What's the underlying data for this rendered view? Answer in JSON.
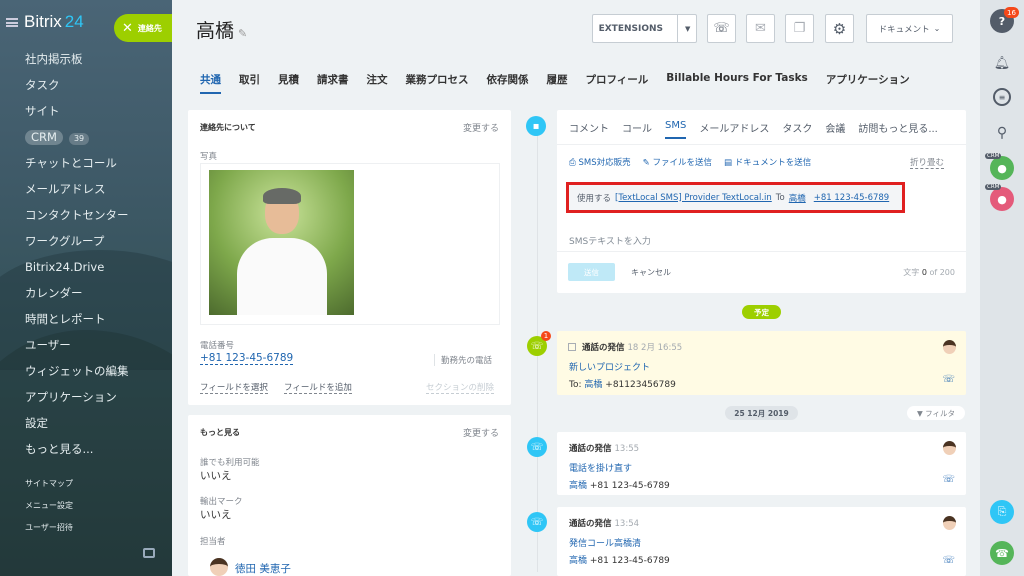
{
  "sidebar": {
    "logo_text": "Bitrix",
    "logo_num": "24",
    "contact_button": "連絡先",
    "menu": [
      "社内掲示板",
      "タスク",
      "サイト",
      "CRM",
      "チャットとコール",
      "メールアドレス",
      "コンタクトセンター",
      "ワークグループ",
      "Bitrix24.Drive",
      "カレンダー",
      "時間とレポート",
      "ユーザー",
      "ウィジェットの編集",
      "アプリケーション",
      "設定",
      "もっと見る..."
    ],
    "crm_count": "39",
    "submenu": [
      "サイトマップ",
      "メニュー設定",
      "ユーザー招待"
    ]
  },
  "header": {
    "title": "高橋",
    "extensions": "EXTENSIONS",
    "documents": "ドキュメント"
  },
  "tabs": [
    "共通",
    "取引",
    "見積",
    "請求書",
    "注文",
    "業務プロセス",
    "依存関係",
    "履歴",
    "プロフィール",
    "Billable Hours For Tasks",
    "アプリケーション"
  ],
  "about": {
    "title": "連絡先について",
    "edit": "変更する",
    "photo_label": "写真",
    "phone_label": "電話番号",
    "phone": "+81 123-45-6789",
    "phone_type": "勤務先の電話",
    "select_field": "フィールドを選択",
    "add_field": "フィールドを追加",
    "delete_section": "セクションの削除"
  },
  "more": {
    "title": "もっと見る",
    "edit": "変更する",
    "available_label": "誰でも利用可能",
    "available_value": "いいえ",
    "import_label": "輸出マーク",
    "import_value": "いいえ",
    "owner_label": "担当者",
    "owner_name": "徳田 美恵子"
  },
  "activity": {
    "tabs": [
      "コメント",
      "コール",
      "SMS",
      "メールアドレス",
      "タスク",
      "会議",
      "訪問もっと見る..."
    ],
    "tools": [
      "SMS対応販売",
      "ファイルを送信",
      "ドキュメントを送信"
    ],
    "fold": "折り畳む",
    "provider_prefix": "使用する",
    "provider": "[TextLocal SMS] Provider TextLocal.in",
    "to": "To",
    "to_name": "高橋",
    "to_phone": "+81 123-45-6789",
    "placeholder": "SMSテキストを入力",
    "send": "送信",
    "cancel": "キャンセル",
    "counter_label": "文字",
    "counter": "0",
    "counter_of": "of",
    "counter_max": "200"
  },
  "timeline": {
    "planned": "予定",
    "date": "25 12月 2019",
    "filter": "フィルタ",
    "badge": "1",
    "events": [
      {
        "title": "通話の発信",
        "time": "18 2月 16:55",
        "subject": "新しいプロジェクト",
        "line2_prefix": "To:",
        "line2_name": "高橋",
        "line2_phone": "+81123456789"
      },
      {
        "title": "通話の発信",
        "time": "13:55",
        "subject": "電話を掛け直す",
        "line2_prefix": "",
        "line2_name": "高橋",
        "line2_phone": "+81 123-45-6789"
      },
      {
        "title": "通話の発信",
        "time": "13:54",
        "subject": "発信コール高橋清",
        "line2_prefix": "",
        "line2_name": "高橋",
        "line2_phone": "+81 123-45-6789"
      }
    ]
  },
  "rightpanel": {
    "help_badge": "16",
    "crm_tag": "CRM"
  }
}
